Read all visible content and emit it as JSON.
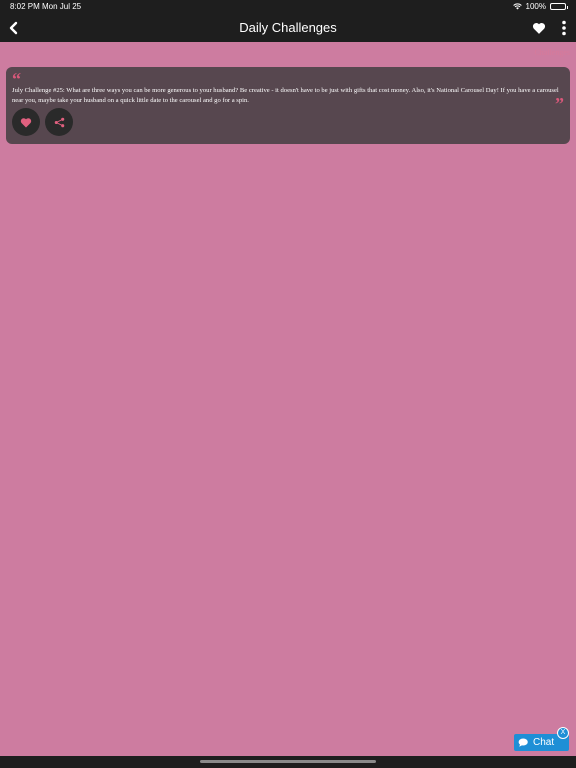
{
  "status": {
    "time": "8:02 PM",
    "date": "Mon Jul 25",
    "battery": "100%"
  },
  "nav": {
    "title": "Daily Challenges"
  },
  "edge_text": "Challenges",
  "challenge": {
    "text": "July Challenge #25: What are three ways you can be more generous to your husband? Be creative - it doesn't have to be just with gifts that cost money. Also, it's National Carousel Day! If you have a carousel near you, maybe take your husband on a quick little date to the carousel and go for a spin.",
    "quote_open": "“",
    "quote_close": "”"
  },
  "chat": {
    "label": "Chat",
    "close": "X"
  },
  "colors": {
    "background": "#cd7ca0",
    "bar": "#1e1e1e",
    "card": "#57474f",
    "accent": "#d9587a",
    "chat": "#1e8fd6"
  },
  "icons": [
    "back-arrow-icon",
    "heart-icon",
    "more-vertical-icon",
    "like-heart-icon",
    "share-icon",
    "chat-bubble-icon",
    "wifi-icon",
    "battery-icon"
  ]
}
